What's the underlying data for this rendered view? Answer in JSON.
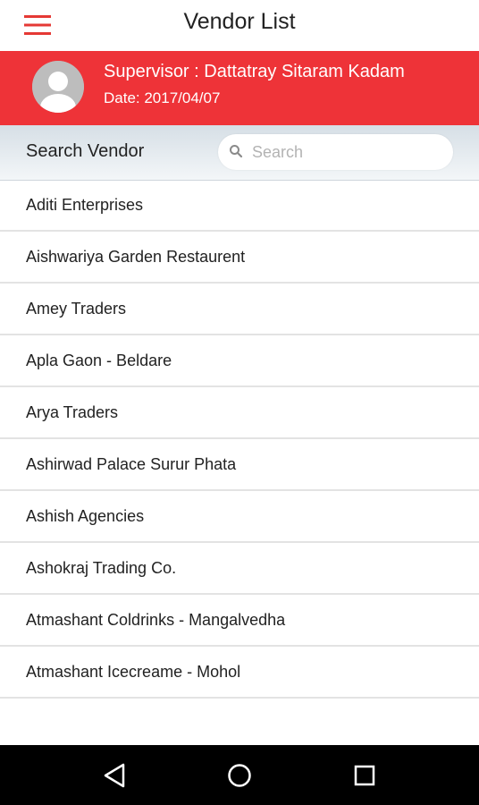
{
  "appbar": {
    "title": "Vendor List",
    "menu_icon": "hamburger-menu-icon"
  },
  "banner": {
    "supervisor": "Supervisor : Dattatray Sitaram Kadam",
    "date": "Date: 2017/04/07",
    "avatar_icon": "user-avatar-icon",
    "color": "#ee3338"
  },
  "search": {
    "label": "Search Vendor",
    "placeholder": "Search",
    "value": "",
    "icon": "search-icon"
  },
  "vendors": [
    "Aditi Enterprises",
    "Aishwariya Garden Restaurent",
    "Amey Traders",
    "Apla Gaon - Beldare",
    "Arya Traders",
    "Ashirwad Palace Surur Phata",
    "Ashish Agencies",
    "Ashokraj Trading Co.",
    "Atmashant Coldrinks - Mangalvedha",
    "Atmashant Icecreame - Mohol"
  ],
  "navbar": {
    "icons": [
      "back-triangle-icon",
      "home-circle-icon",
      "recents-square-icon"
    ]
  }
}
